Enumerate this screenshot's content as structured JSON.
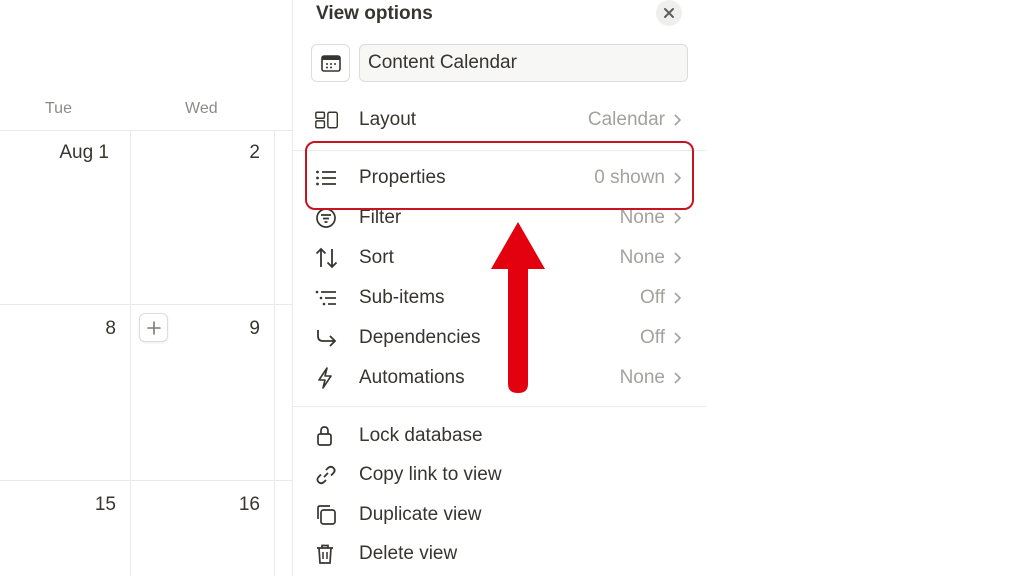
{
  "calendar": {
    "day_headers": [
      "Tue",
      "Wed"
    ],
    "weeks": [
      [
        "Aug 1",
        "2"
      ],
      [
        "8",
        "9"
      ],
      [
        "15",
        "16"
      ]
    ]
  },
  "panel": {
    "title": "View options",
    "view_name": "Content Calendar",
    "settings": [
      {
        "label": "Layout",
        "value": "Calendar",
        "icon": "layout-icon"
      },
      {
        "label": "Properties",
        "value": "0 shown",
        "icon": "list-icon"
      },
      {
        "label": "Filter",
        "value": "None",
        "icon": "filter-icon"
      },
      {
        "label": "Sort",
        "value": "None",
        "icon": "sort-icon"
      },
      {
        "label": "Sub-items",
        "value": "Off",
        "icon": "sub-items-icon"
      },
      {
        "label": "Dependencies",
        "value": "Off",
        "icon": "dependencies-icon"
      },
      {
        "label": "Automations",
        "value": "None",
        "icon": "lightning-icon"
      }
    ],
    "actions": [
      {
        "label": "Lock database",
        "icon": "lock-icon"
      },
      {
        "label": "Copy link to view",
        "icon": "link-icon"
      },
      {
        "label": "Duplicate view",
        "icon": "duplicate-icon"
      },
      {
        "label": "Delete view",
        "icon": "trash-icon"
      }
    ]
  },
  "colors": {
    "highlight": "#c8141e",
    "arrow": "#e3000f"
  }
}
